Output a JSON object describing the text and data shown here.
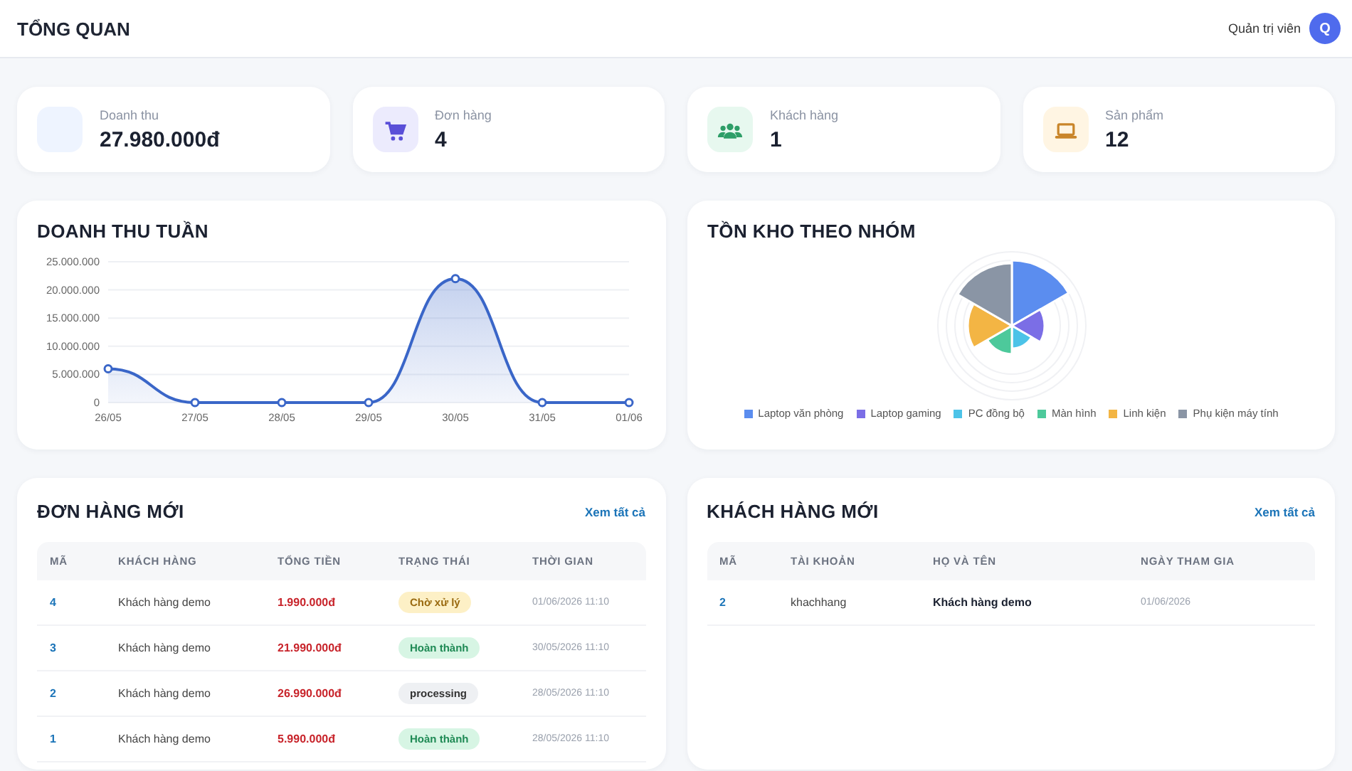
{
  "header": {
    "title": "TỔNG QUAN",
    "role": "Quản trị viên",
    "avatar": "Q"
  },
  "stats": [
    {
      "label": "Doanh thu",
      "value": "27.980.000đ"
    },
    {
      "label": "Đơn hàng",
      "value": "4"
    },
    {
      "label": "Khách hàng",
      "value": "1"
    },
    {
      "label": "Sản phẩm",
      "value": "12"
    }
  ],
  "revenue_chart": {
    "title": "DOANH THU TUẦN",
    "chart_data": {
      "type": "area",
      "categories": [
        "26/05",
        "27/05",
        "28/05",
        "29/05",
        "30/05",
        "31/05",
        "01/06"
      ],
      "grid": true,
      "series": [
        {
          "color": "#3a66c8",
          "values": [
            6000000,
            0,
            0,
            0,
            22000000,
            0,
            0
          ]
        }
      ],
      "ylim": [
        0,
        25000000
      ],
      "yticks": [
        {
          "value": 0,
          "label": "0"
        },
        {
          "value": 5000000,
          "label": "5.000.000"
        },
        {
          "value": 10000000,
          "label": "10.000.000"
        },
        {
          "value": 15000000,
          "label": "15.000.000"
        },
        {
          "value": 20000000,
          "label": "20.000.000"
        },
        {
          "value": 25000000,
          "label": "25.000.000"
        }
      ]
    }
  },
  "stock_chart": {
    "title": "TỒN KHO THEO NHÓM",
    "legend": [
      {
        "label": "Laptop văn phòng",
        "color": "#5b8def"
      },
      {
        "label": "Laptop gaming",
        "color": "#7b6ee6"
      },
      {
        "label": "PC đồng bộ",
        "color": "#4cc3e8"
      },
      {
        "label": "Màn hình",
        "color": "#4dc99b"
      },
      {
        "label": "Linh kiện",
        "color": "#f3b544"
      },
      {
        "label": "Phụ kiện máy tính",
        "color": "#8a95a5"
      }
    ]
  },
  "orders": {
    "title": "ĐƠN HÀNG MỚI",
    "link": "Xem tất cả",
    "columns": [
      "MÃ",
      "KHÁCH HÀNG",
      "TỔNG TIỀN",
      "TRẠNG THÁI",
      "THỜI GIAN"
    ],
    "rows": [
      {
        "id": "4",
        "customer": "Khách hàng demo",
        "total": "1.990.000đ",
        "status": "Chờ xử lý",
        "kind": "pending",
        "time": "01/06/2026 11:10"
      },
      {
        "id": "3",
        "customer": "Khách hàng demo",
        "total": "21.990.000đ",
        "status": "Hoàn thành",
        "kind": "done",
        "time": "30/05/2026 11:10"
      },
      {
        "id": "2",
        "customer": "Khách hàng demo",
        "total": "26.990.000đ",
        "status": "processing",
        "kind": "processing",
        "time": "28/05/2026 11:10"
      },
      {
        "id": "1",
        "customer": "Khách hàng demo",
        "total": "5.990.000đ",
        "status": "Hoàn thành",
        "kind": "done",
        "time": "28/05/2026 11:10"
      }
    ]
  },
  "customers": {
    "title": "KHÁCH HÀNG MỚI",
    "link": "Xem tất cả",
    "columns": [
      "MÃ",
      "TÀI KHOẢN",
      "HỌ VÀ TÊN",
      "NGÀY THAM GIA"
    ],
    "rows": [
      {
        "id": "2",
        "account": "khachhang",
        "name": "Khách hàng demo",
        "joined": "01/06/2026"
      }
    ]
  }
}
